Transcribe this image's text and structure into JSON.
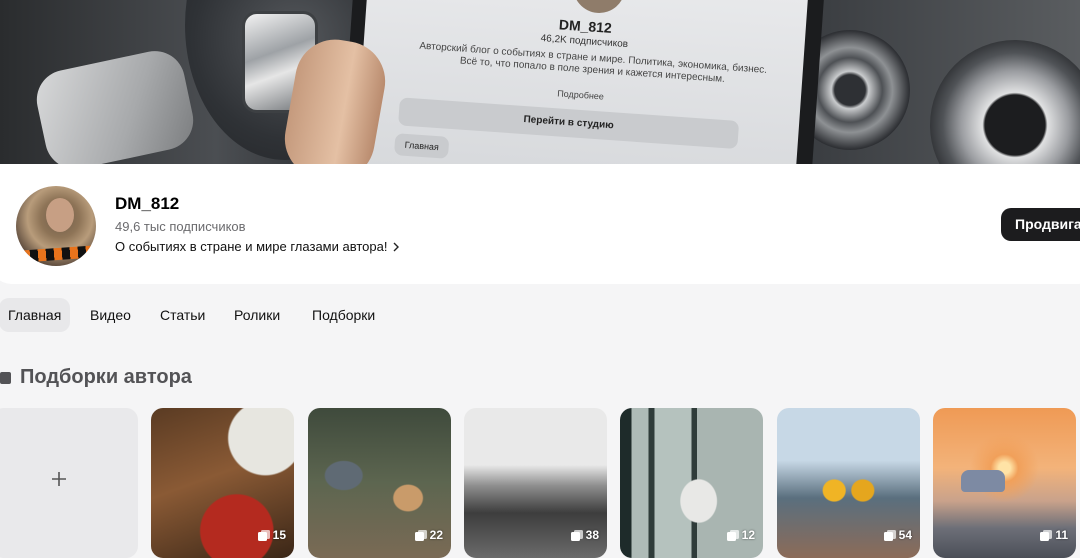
{
  "cover": {
    "phone_screen": {
      "name": "DM_812",
      "subscribers": "46,2K подписчиков",
      "description": "Авторский блог о событиях в стране и мире. Политика, экономика, бизнес. Всё то, что попало в поле зрения и кажется интересным.",
      "more_link": "Подробнее",
      "studio_button": "Перейти в студию",
      "tab": "Главная"
    }
  },
  "channel": {
    "name": "DM_812",
    "subscribers": "49,6 тыс подписчиков",
    "description": "О событиях в стране и мире глазами автора!",
    "promote_button": "Продвигать"
  },
  "tabs": [
    {
      "label": "Главная",
      "active": true
    },
    {
      "label": "Видео",
      "active": false
    },
    {
      "label": "Статьи",
      "active": false
    },
    {
      "label": "Ролики",
      "active": false
    },
    {
      "label": "Подборки",
      "active": false
    }
  ],
  "collections": {
    "title": "Подборки автора",
    "create_icon": "plus-icon",
    "items": [
      {
        "count": "15"
      },
      {
        "count": "22"
      },
      {
        "count": "38"
      },
      {
        "count": "12"
      },
      {
        "count": "54"
      },
      {
        "count": "11"
      }
    ]
  },
  "colors": {
    "promote_bg": "#1c1c1e",
    "active_tab_bg": "#e8e8ea",
    "page_bg": "#f5f5f6",
    "section_title": "#535356"
  }
}
